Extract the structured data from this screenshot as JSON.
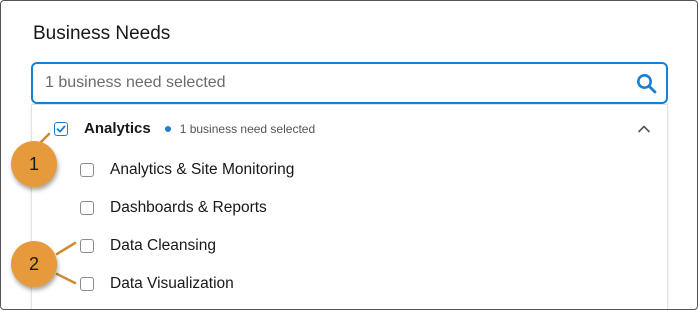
{
  "section": {
    "title": "Business Needs"
  },
  "search": {
    "placeholder": "1 business need selected",
    "icon": "search-icon"
  },
  "group": {
    "label": "Analytics",
    "checked": true,
    "status": "1 business need selected",
    "status_color": "#1b7fd1",
    "expanded": true
  },
  "items": [
    {
      "label": "Analytics & Site Monitoring",
      "checked": false
    },
    {
      "label": "Dashboards & Reports",
      "checked": false
    },
    {
      "label": "Data Cleansing",
      "checked": false
    },
    {
      "label": "Data Visualization",
      "checked": false
    }
  ],
  "callouts": [
    {
      "number": "1"
    },
    {
      "number": "2"
    }
  ],
  "colors": {
    "accent": "#1b7fd1",
    "callout": "#e79a3c"
  }
}
